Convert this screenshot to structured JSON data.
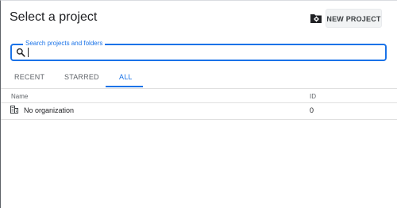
{
  "dialog": {
    "title": "Select a project",
    "new_project_label": "NEW PROJECT",
    "folder_icon": "folder-settings-icon"
  },
  "search": {
    "label": "Search projects and folders",
    "value": "",
    "icon": "search-icon"
  },
  "tabs": [
    {
      "label": "RECENT",
      "active": false
    },
    {
      "label": "STARRED",
      "active": false
    },
    {
      "label": "ALL",
      "active": true
    }
  ],
  "table": {
    "columns": [
      "Name",
      "ID"
    ],
    "rows": [
      {
        "name": "No organization",
        "id": "0",
        "icon": "organization-icon"
      }
    ]
  },
  "colors": {
    "accent": "#1a73e8",
    "text": "#202124",
    "muted": "#5f6368"
  }
}
